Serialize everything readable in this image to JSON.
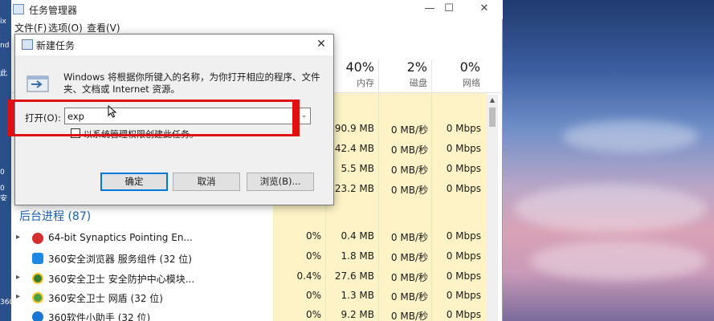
{
  "desktop": {
    "left_icons": [
      {
        "label": "ix"
      },
      {
        "label": "nd"
      },
      {
        "label": "此"
      },
      {
        "label": "0"
      },
      {
        "label": "0安"
      },
      {
        "label": "360"
      },
      {
        "label": "360"
      }
    ]
  },
  "taskmgr": {
    "title": "任务管理器",
    "window_controls": {
      "minimize": "—",
      "maximize": "☐",
      "close": "✕"
    },
    "menu": [
      "文件(F)",
      "选项(O)",
      "查看(V)"
    ],
    "columns": [
      {
        "percent": "40%",
        "name": "内存"
      },
      {
        "percent": "2%",
        "name": "磁盘"
      },
      {
        "percent": "0%",
        "name": "网络"
      }
    ],
    "app_rows": [
      {
        "cpu": "",
        "memory": "90.9 MB",
        "disk": "0 MB/秒",
        "network": "0 Mbps"
      },
      {
        "cpu": "",
        "memory": "42.4 MB",
        "disk": "0 MB/秒",
        "network": "0 Mbps"
      },
      {
        "cpu": "",
        "memory": "5.5 MB",
        "disk": "0 MB/秒",
        "network": "0 Mbps"
      },
      {
        "cpu": "",
        "memory": "23.2 MB",
        "disk": "0 MB/秒",
        "network": "0 Mbps"
      }
    ],
    "background_section": "后台进程 (87)",
    "background_rows": [
      {
        "name": "64-bit Synaptics Pointing En...",
        "expandable": true,
        "icon": "synaptics-icon",
        "icon_color": "#d32f2f",
        "cpu": "0%",
        "memory": "0.4 MB",
        "disk": "0 MB/秒",
        "network": "0 Mbps"
      },
      {
        "name": "360安全浏览器 服务组件 (32 位)",
        "expandable": false,
        "icon": "360-browser-icon",
        "icon_color": "#1e88e5",
        "cpu": "0%",
        "memory": "1.8 MB",
        "disk": "0 MB/秒",
        "network": "0 Mbps"
      },
      {
        "name": "360安全卫士 安全防护中心模块...",
        "expandable": true,
        "icon": "360-guard-icon",
        "icon_color": "#2e7d32",
        "cpu": "0.4%",
        "memory": "27.6 MB",
        "disk": "0 MB/秒",
        "network": "0 Mbps"
      },
      {
        "name": "360安全卫士 网盾 (32 位)",
        "expandable": true,
        "icon": "360-shield-icon",
        "icon_color": "#43a047",
        "cpu": "0%",
        "memory": "1.3 MB",
        "disk": "0 MB/秒",
        "network": "0 Mbps"
      },
      {
        "name": "360软件小助手 (32 位)",
        "expandable": false,
        "icon": "360-helper-icon",
        "icon_color": "#1976d2",
        "cpu": "0%",
        "memory": "9.2 MB",
        "disk": "0 MB/秒",
        "network": "0 Mbps"
      }
    ]
  },
  "run_dialog": {
    "title": "新建任务",
    "description": "Windows 将根据你所键入的名称，为你打开相应的程序、文件夹、文档或 Internet 资源。",
    "open_label": "打开(O):",
    "input_value": "exp",
    "admin_checkbox_label": "以系统管理权限创建此任务。",
    "buttons": {
      "ok": "确定",
      "cancel": "取消",
      "browse": "浏览(B)..."
    }
  },
  "colors": {
    "highlight_red": "#e01010",
    "column_highlight": "#fdf3c6",
    "section_blue": "#1a5fb4"
  }
}
